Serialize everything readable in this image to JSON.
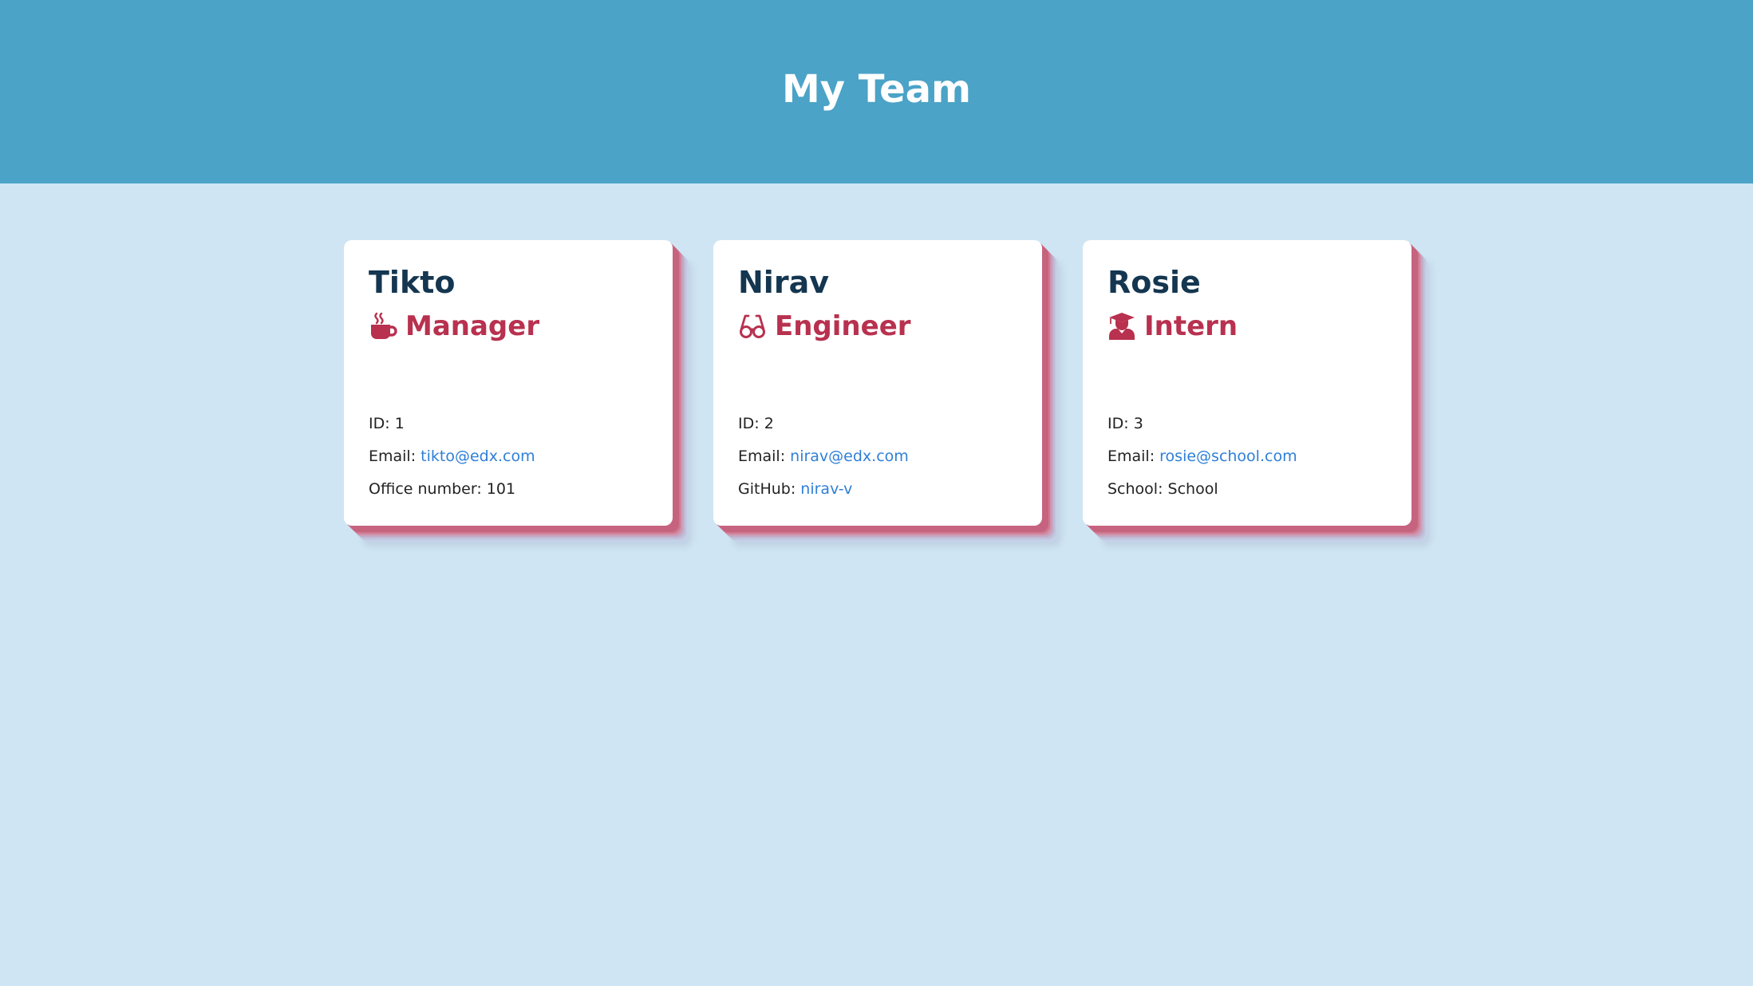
{
  "header": {
    "title": "My Team"
  },
  "colors": {
    "header_bg": "#4ba3c7",
    "page_bg": "#cfe5f3",
    "name": "#143650",
    "role": "#b8314f",
    "link": "#2f7fd8"
  },
  "team": [
    {
      "name": "Tikto",
      "role": "Manager",
      "icon": "coffee-icon",
      "id_label": "ID: ",
      "id": "1",
      "email_label": "Email: ",
      "email": "tikto@edx.com",
      "extra_label": "Office number: ",
      "extra_value": "101"
    },
    {
      "name": "Nirav",
      "role": "Engineer",
      "icon": "glasses-icon",
      "id_label": "ID: ",
      "id": "2",
      "email_label": "Email: ",
      "email": "nirav@edx.com",
      "extra_label": "GitHub: ",
      "extra_value": "nirav-v"
    },
    {
      "name": "Rosie",
      "role": "Intern",
      "icon": "graduate-icon",
      "id_label": "ID: ",
      "id": "3",
      "email_label": "Email: ",
      "email": "rosie@school.com",
      "extra_label": "School: ",
      "extra_value": "School"
    }
  ]
}
